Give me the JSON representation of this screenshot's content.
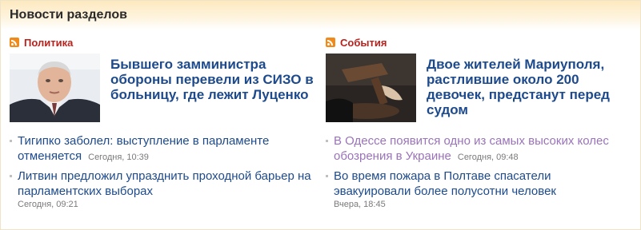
{
  "header": {
    "title": "Новости разделов"
  },
  "left": {
    "section": "Политика",
    "feature_title": "Бывшего замминистра обороны перевели из СИЗО в больницу, где лежит Луценко",
    "items": [
      {
        "text": "Тигипко заболел: выступление в парламенте отменяется",
        "time": "Сегодня, 10:39"
      },
      {
        "text": "Литвин предложил упразднить проходной барьер на парламентских выборах",
        "time": "Сегодня, 09:21"
      }
    ]
  },
  "right": {
    "section": "События",
    "feature_title": "Двое жителей Мариуполя, растлившие около 200 девочек, предстанут перед судом",
    "items": [
      {
        "text": "В Одессе появится одно из самых высоких колес обозрения в Украине",
        "time": "Сегодня, 09:48"
      },
      {
        "text": "Во время пожара в Полтаве спасатели эвакуировали более полусотни человек",
        "time": "Вчера, 18:45"
      }
    ]
  },
  "colors": {
    "link": "#1d4a8c",
    "visited": "#9a73b9",
    "section": "#b8221d",
    "rss": "#f08a1a"
  }
}
